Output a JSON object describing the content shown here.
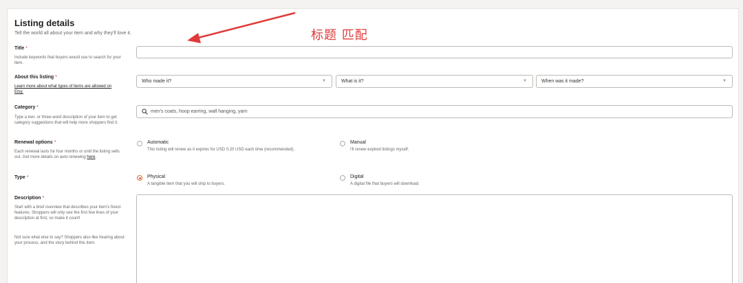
{
  "section": {
    "title": "Listing details",
    "subtitle": "Tell the world all about your item and why they'll love it."
  },
  "title_field": {
    "label": "Title",
    "required_mark": "*",
    "help": "Include keywords that buyers would use to search for your item.",
    "value": ""
  },
  "about": {
    "label": "About this listing",
    "required_mark": "*",
    "help_link": "Learn more about what types of items are allowed on Etsy.",
    "selects": [
      {
        "value": "Who made it?"
      },
      {
        "value": "What is it?"
      },
      {
        "value": "When was it made?"
      }
    ]
  },
  "category": {
    "label": "Category",
    "required_mark": "*",
    "help": "Type a two- or three-word description of your item to get category suggestions that will help more shoppers find it.",
    "placeholder": "men's coats, hoop earring, wall hanging, yarn"
  },
  "renewal": {
    "label": "Renewal options",
    "required_mark": "*",
    "help_prefix": "Each renewal lasts for four months or until the listing sells out. Get more details on auto-renewing ",
    "help_link": "here",
    "help_suffix": ".",
    "options": [
      {
        "title": "Automatic",
        "desc": "This listing will renew as it expires for USD 0.20 USD each time (recommended).",
        "selected": false
      },
      {
        "title": "Manual",
        "desc": "I'll renew expired listings myself.",
        "selected": false
      }
    ]
  },
  "type": {
    "label": "Type",
    "required_mark": "*",
    "options": [
      {
        "title": "Physical",
        "desc": "A tangible item that you will ship to buyers.",
        "selected": true
      },
      {
        "title": "Digital",
        "desc": "A digital file that buyers will download.",
        "selected": false
      }
    ]
  },
  "description": {
    "label": "Description",
    "required_mark": "*",
    "help1": "Start with a brief overview that describes your item's finest features. Shoppers will only see the first few lines of your description at first, so make it count!",
    "help2": "Not sure what else to say? Shoppers also like hearing about your process, and the story behind this item.",
    "value": ""
  },
  "annotation": {
    "text": "标题 匹配",
    "color": "#e03a3a"
  },
  "colors": {
    "accent": "#e2662f",
    "border": "#bcbab5"
  },
  "icons": {
    "search": "search-icon",
    "chevron": "chevron-down-icon"
  }
}
